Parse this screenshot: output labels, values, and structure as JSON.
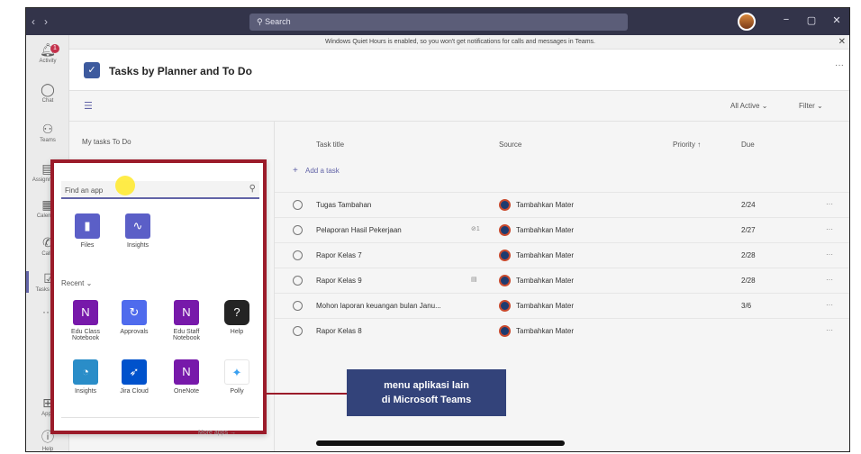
{
  "titlebar": {
    "nav_back": "‹",
    "nav_forward": "›",
    "search_placeholder": "Search",
    "minimize": "−",
    "maximize": "▢",
    "close": "✕"
  },
  "rail": {
    "activity_label": "Activity",
    "activity_badge": "1",
    "chat_label": "Chat",
    "teams_label": "Teams",
    "assignments_label": "Assignments",
    "calendar_label": "Calendar",
    "calls_label": "Calls",
    "tasks_label": "Tasks by ...",
    "more": "···",
    "apps_label": "Apps",
    "help_label": "Help"
  },
  "notice": {
    "text": "Windows Quiet Hours is enabled, so you won't get notifications for calls and messages in Teams.",
    "close": "✕"
  },
  "app": {
    "title": "Tasks by Planner and To Do",
    "more": "···"
  },
  "toolbar": {
    "all_active": "All Active",
    "filter": "Filter"
  },
  "left_pane": {
    "my_tasks": "My tasks",
    "to_do": "To Do"
  },
  "table": {
    "headers": {
      "title": "Task title",
      "source": "Source",
      "priority": "Priority ↑",
      "due": "Due"
    },
    "add_task": "Add a task",
    "rows": [
      {
        "title": "Tugas Tambahan",
        "meta": "",
        "source": "Tambahkan Mater",
        "due": "2/24",
        "more": "···"
      },
      {
        "title": "Pelaporan Hasil Pekerjaan",
        "meta": "⊘1",
        "source": "Tambahkan Mater",
        "due": "2/27",
        "more": "···"
      },
      {
        "title": "Rapor Kelas 7",
        "meta": "",
        "source": "Tambahkan Mater",
        "due": "2/28",
        "more": "···"
      },
      {
        "title": "Rapor Kelas 9",
        "meta": "▤",
        "source": "Tambahkan Mater",
        "due": "2/28",
        "more": "···"
      },
      {
        "title": "Mohon laporan keuangan bulan Janu...",
        "meta": "",
        "source": "Tambahkan Mater",
        "due": "3/6",
        "more": "···"
      },
      {
        "title": "Rapor Kelas 8",
        "meta": "",
        "source": "Tambahkan Mater",
        "due": "",
        "more": "···"
      }
    ]
  },
  "popup": {
    "search_placeholder": "Find an app",
    "pinned": [
      {
        "label": "Files",
        "color": "#5b5fc7"
      },
      {
        "label": "Insights",
        "color": "#5b5fc7"
      }
    ],
    "recent_label": "Recent ⌄",
    "recent": [
      {
        "label": "Edu Class Notebook",
        "color": "#7719aa"
      },
      {
        "label": "Approvals",
        "color": "#4f6bed"
      },
      {
        "label": "Edu Staff Notebook",
        "color": "#7719aa"
      },
      {
        "label": "Help",
        "color": "#242424"
      },
      {
        "label": "Insights",
        "color": "#2a8dc8"
      },
      {
        "label": "Jira Cloud",
        "color": "#0052cc"
      },
      {
        "label": "OneNote",
        "color": "#7719aa"
      },
      {
        "label": "Polly",
        "color": "#ffffff"
      }
    ],
    "more_apps": "More apps →"
  },
  "callout": {
    "line1": "menu aplikasi lain",
    "line2": "di Microsoft Teams"
  }
}
